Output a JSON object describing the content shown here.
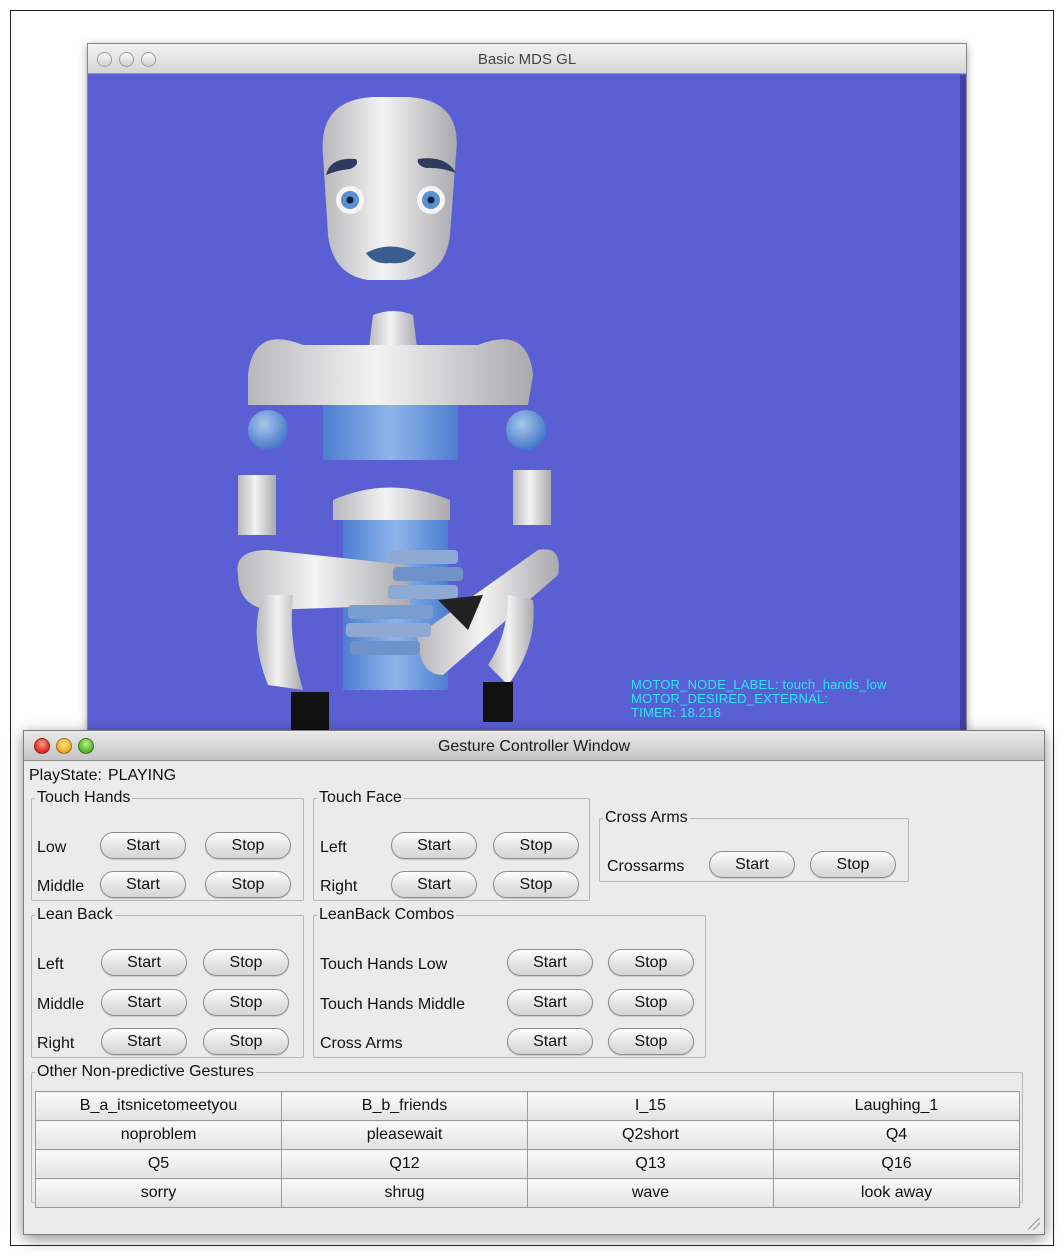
{
  "gl_window": {
    "title": "Basic MDS GL",
    "background_color": "#5a5fd3",
    "overlay": {
      "line1": "MOTOR_NODE_LABEL: touch_hands_low",
      "line2": "MOTOR_DESIRED_EXTERNAL:",
      "line3": "TIMER: 18.216",
      "color": "#2ee6f4"
    }
  },
  "gc_window": {
    "title": "Gesture Controller Window",
    "playstate_label": "PlayState:",
    "playstate_value": "PLAYING",
    "touch_hands": {
      "legend": "Touch Hands",
      "rows": [
        {
          "label": "Low",
          "start": "Start",
          "stop": "Stop"
        },
        {
          "label": "Middle",
          "start": "Start",
          "stop": "Stop"
        }
      ]
    },
    "touch_face": {
      "legend": "Touch Face",
      "rows": [
        {
          "label": "Left",
          "start": "Start",
          "stop": "Stop"
        },
        {
          "label": "Right",
          "start": "Start",
          "stop": "Stop"
        }
      ]
    },
    "cross_arms": {
      "legend": "Cross Arms",
      "rows": [
        {
          "label": "Crossarms",
          "start": "Start",
          "stop": "Stop"
        }
      ]
    },
    "lean_back": {
      "legend": "Lean Back",
      "rows": [
        {
          "label": "Left",
          "start": "Start",
          "stop": "Stop"
        },
        {
          "label": "Middle",
          "start": "Start",
          "stop": "Stop"
        },
        {
          "label": "Right",
          "start": "Start",
          "stop": "Stop"
        }
      ]
    },
    "leanback_combos": {
      "legend": "LeanBack Combos",
      "rows": [
        {
          "label": "Touch Hands Low",
          "start": "Start",
          "stop": "Stop"
        },
        {
          "label": "Touch Hands Middle",
          "start": "Start",
          "stop": "Stop"
        },
        {
          "label": "Cross Arms",
          "start": "Start",
          "stop": "Stop"
        }
      ]
    },
    "other_gestures": {
      "legend": "Other Non-predictive Gestures",
      "buttons": [
        [
          "B_a_itsnicetomeetyou",
          "B_b_friends",
          "I_15",
          "Laughing_1"
        ],
        [
          "noproblem",
          "pleasewait",
          "Q2short",
          "Q4"
        ],
        [
          "Q5",
          "Q12",
          "Q13",
          "Q16"
        ],
        [
          "sorry",
          "shrug",
          "wave",
          "look away"
        ]
      ]
    }
  }
}
